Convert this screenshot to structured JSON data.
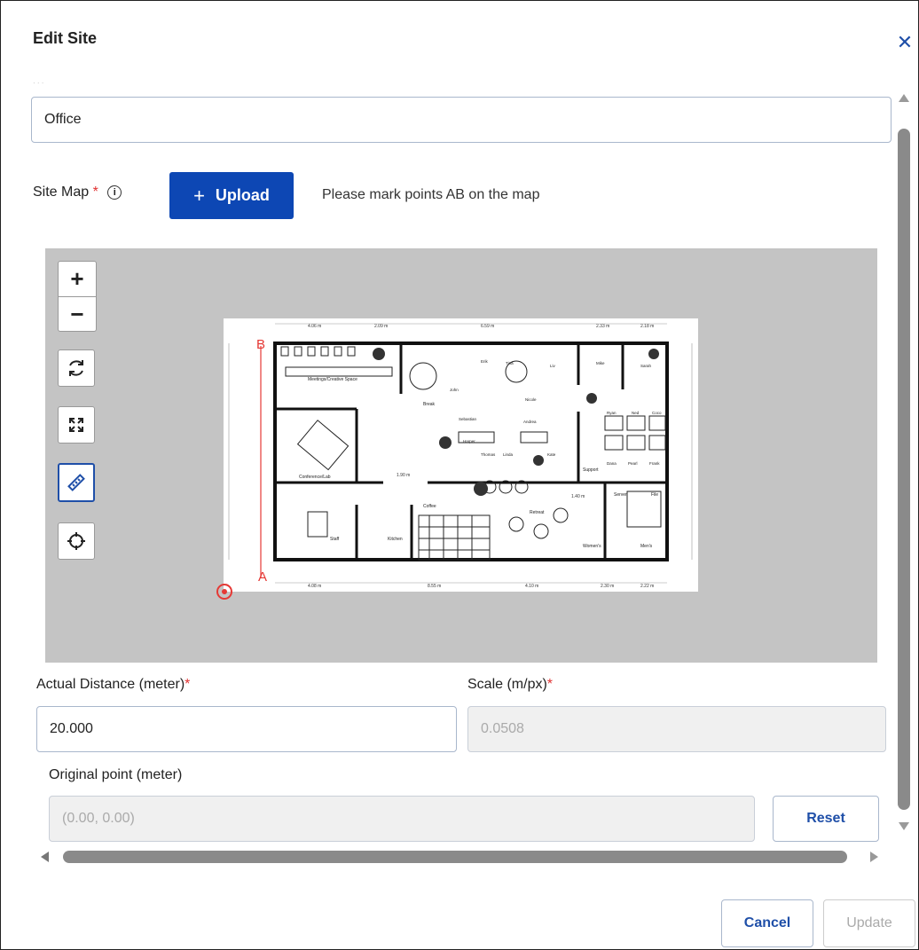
{
  "dialog": {
    "title": "Edit Site",
    "close_icon": "close-icon"
  },
  "site_name": {
    "value": "Office"
  },
  "site_map": {
    "label": "Site Map",
    "required_mark": "*",
    "upload_label": "Upload",
    "hint": "Please mark points AB on the map"
  },
  "map_tools": {
    "zoom_in": "+",
    "zoom_out": "−",
    "icons": [
      "refresh-icon",
      "fit-screen-icon",
      "ruler-icon",
      "crosshair-icon"
    ],
    "active_tool": "ruler-icon"
  },
  "markers": {
    "a": "A",
    "b": "B"
  },
  "floor_plan": {
    "rooms": [
      "Meetings/Creative Space",
      "Conference/Lab",
      "Break",
      "Coffee",
      "Kitchen",
      "Retreat",
      "Support",
      "Server",
      "File",
      "Staff",
      "Women's",
      "Men's"
    ],
    "people": [
      "Erik",
      "John",
      "Tina",
      "Liv",
      "Nicole",
      "Sebastian",
      "Harper",
      "Andrea",
      "Thomas",
      "Linda",
      "Kate",
      "Mike",
      "Sarah",
      "Ryan",
      "Ned",
      "Coco",
      "Dana",
      "Pearl",
      "Frank"
    ],
    "top_dims": [
      "4.06 m",
      "2.09 m",
      "6.59 m",
      "2.33 m",
      "2.18 m"
    ],
    "bottom_dims": [
      "4.08 m",
      "8.55 m",
      "4.10 m",
      "2.30 m",
      "2.22 m"
    ],
    "inner_dims": [
      "1.90 m",
      "1.40 m"
    ]
  },
  "distance": {
    "label": "Actual Distance (meter)",
    "required_mark": "*",
    "value": "20.000"
  },
  "scale": {
    "label": "Scale (m/px)",
    "required_mark": "*",
    "value": "0.0508"
  },
  "origin": {
    "label": "Original point (meter)",
    "placeholder": "(0.00, 0.00)",
    "reset_label": "Reset"
  },
  "footer": {
    "cancel_label": "Cancel",
    "update_label": "Update"
  },
  "colors": {
    "primary": "#0d47b4",
    "accent": "#1f4fa8",
    "required": "#e03131",
    "marker": "#e53935",
    "map_bg": "#c4c4c4"
  }
}
